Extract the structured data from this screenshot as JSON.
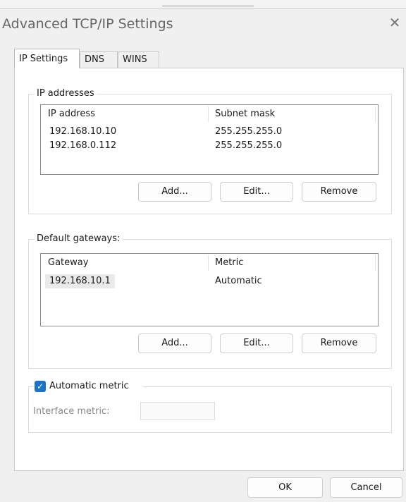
{
  "window": {
    "title": "Advanced TCP/IP Settings"
  },
  "tabs": [
    {
      "label": "IP Settings",
      "active": true
    },
    {
      "label": "DNS",
      "active": false
    },
    {
      "label": "WINS",
      "active": false
    }
  ],
  "ip_addresses": {
    "group_label": "IP addresses",
    "columns": [
      "IP address",
      "Subnet mask"
    ],
    "rows": [
      {
        "ip": "192.168.10.10",
        "mask": "255.255.255.0"
      },
      {
        "ip": "192.168.0.112",
        "mask": "255.255.255.0"
      }
    ],
    "buttons": {
      "add": "Add...",
      "edit": "Edit...",
      "remove": "Remove"
    }
  },
  "default_gateways": {
    "group_label": "Default gateways:",
    "columns": [
      "Gateway",
      "Metric"
    ],
    "rows": [
      {
        "gateway": "192.168.10.1",
        "metric": "Automatic"
      }
    ],
    "buttons": {
      "add": "Add...",
      "edit": "Edit...",
      "remove": "Remove"
    }
  },
  "automatic_metric": {
    "label": "Automatic metric",
    "checked": true,
    "interface_metric_label": "Interface metric:",
    "interface_metric_value": ""
  },
  "footer": {
    "ok": "OK",
    "cancel": "Cancel"
  },
  "colors": {
    "accent": "#1a73c8",
    "panel": "#ffffff",
    "chrome": "#f0f0f0"
  }
}
